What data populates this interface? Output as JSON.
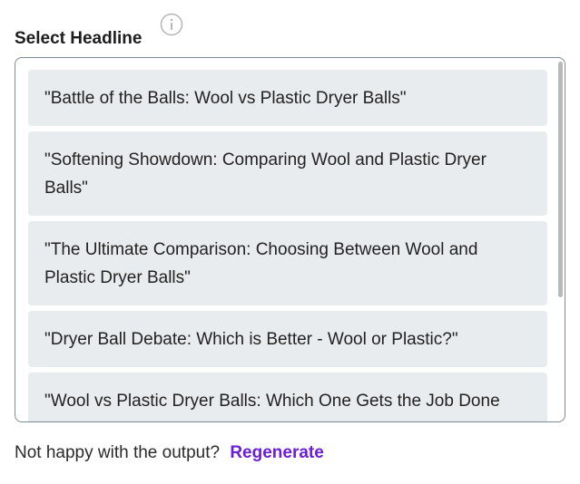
{
  "header": {
    "title": "Select Headline",
    "info_icon": "info-circle-icon"
  },
  "headlines": [
    "\"Battle of the Balls: Wool vs Plastic Dryer Balls\"",
    "\"Softening Showdown: Comparing Wool and Plastic Dryer Balls\"",
    "\"The Ultimate Comparison: Choosing Between Wool and Plastic Dryer Balls\"",
    "\"Dryer Ball Debate: Which is Better - Wool or Plastic?\"",
    "\"Wool vs Plastic Dryer Balls: Which One Gets the Job Done Faster?\""
  ],
  "footer": {
    "prompt": "Not happy with the output?",
    "regenerate_label": "Regenerate"
  },
  "colors": {
    "accent": "#6b1ed6",
    "option_bg": "#e9ecef",
    "border": "#7c8a96"
  }
}
